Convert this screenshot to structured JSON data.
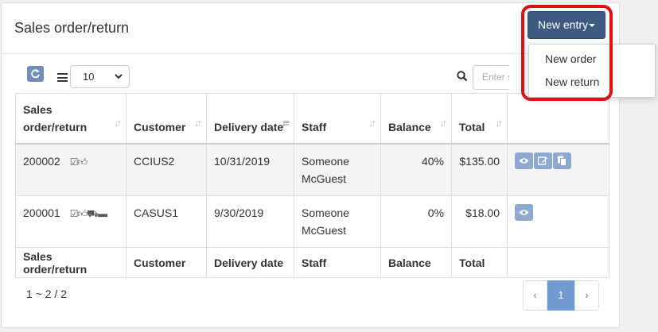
{
  "header": {
    "title": "Sales order/return"
  },
  "new_entry": {
    "label": "New entry",
    "menu_items": [
      "New order",
      "New return"
    ]
  },
  "toolbar": {
    "page_size": "10",
    "search_placeholder": "Enter search"
  },
  "table": {
    "headers": [
      "Sales order/return",
      "Customer",
      "Delivery date",
      "Staff",
      "Balance",
      "Total",
      ""
    ],
    "rows": [
      {
        "id": "200002",
        "status_icons": [
          "checkbox-icon",
          "thumbs-up-icon"
        ],
        "customer": "CCIUS2",
        "delivery_date": "10/31/2019",
        "staff": "Someone McGuest",
        "balance": "40%",
        "total": "$135.00",
        "actions": [
          "view-icon",
          "edit-icon",
          "copy-icon"
        ]
      },
      {
        "id": "200001",
        "status_icons": [
          "checkbox-icon",
          "thumbs-up-icon",
          "truck-icon",
          "invoice-icon"
        ],
        "customer": "CASUS1",
        "delivery_date": "9/30/2019",
        "staff": "Someone McGuest",
        "balance": "0%",
        "total": "$18.00",
        "actions": [
          "view-icon"
        ]
      }
    ],
    "footer": [
      "Sales order/return",
      "Customer",
      "Delivery date",
      "Staff",
      "Balance",
      "Total",
      ""
    ]
  },
  "pagination": {
    "info": "1 ~ 2 / 2",
    "prev": "‹",
    "current": "1",
    "next": "›"
  },
  "colors": {
    "primary_button": "#3d5a80",
    "action_button": "#8ea8cf",
    "highlight_ring": "#e01010",
    "active_page": "#6f9bd0"
  }
}
